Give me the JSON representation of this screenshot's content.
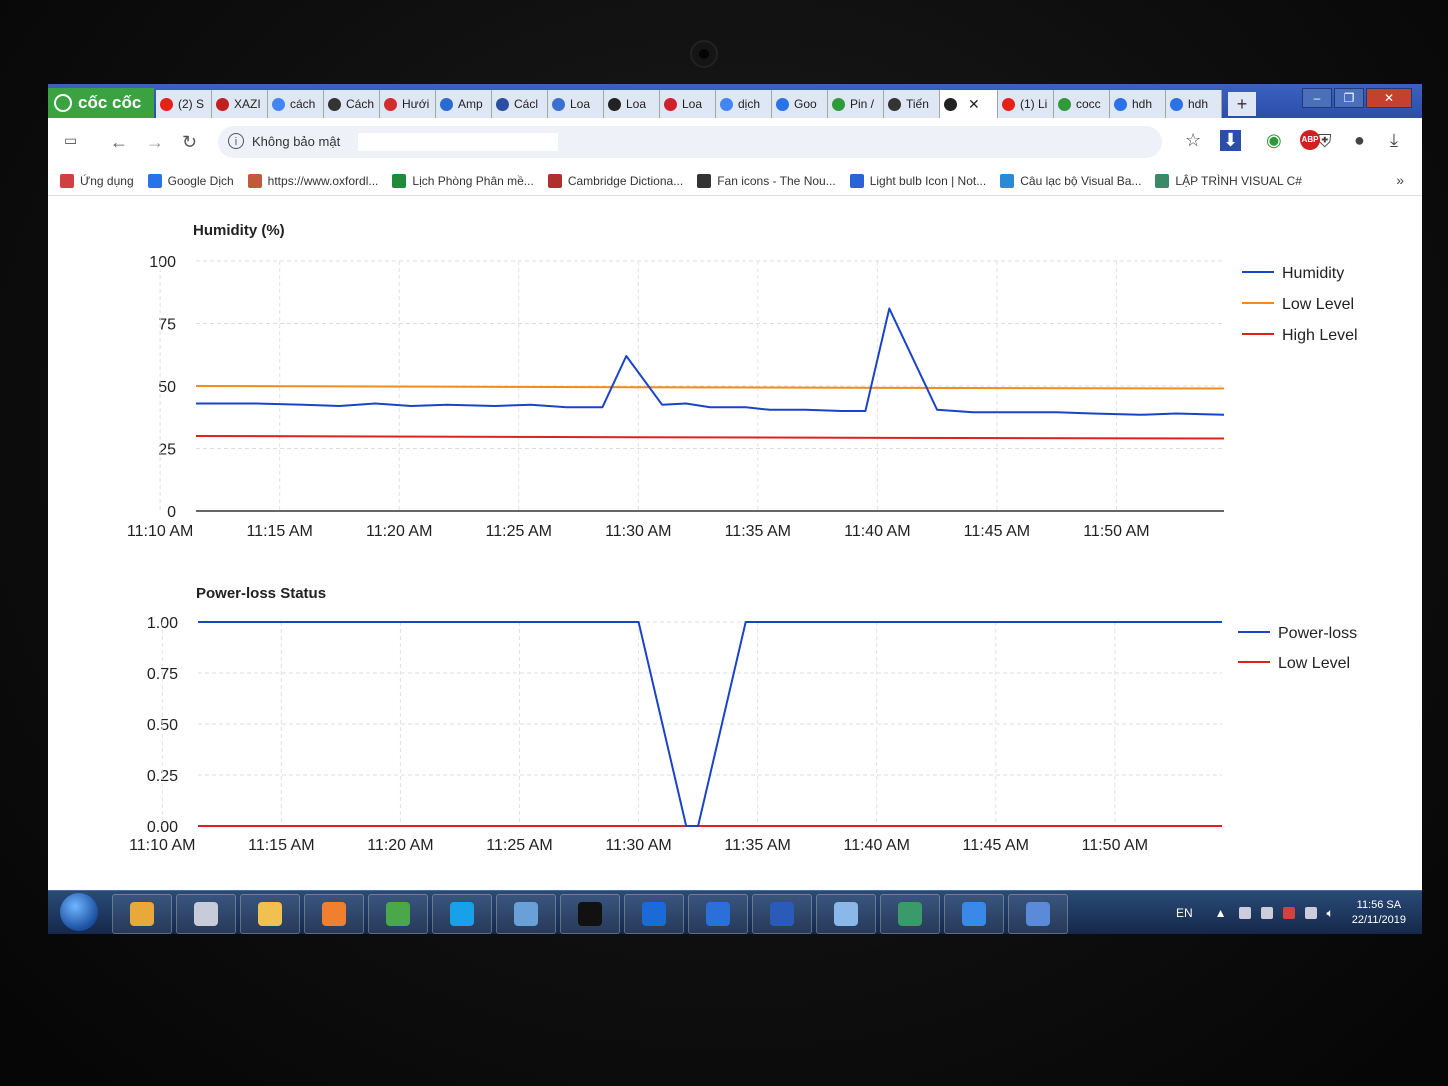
{
  "browser": {
    "brand": "cốc cốc",
    "tabs": [
      {
        "label": "(2) S",
        "icon": "youtube-icon",
        "color": "#e62117"
      },
      {
        "label": "XAZI",
        "icon": "block-icon",
        "color": "#c02020"
      },
      {
        "label": "cách",
        "icon": "google-icon",
        "color": "#4285f4"
      },
      {
        "label": "Cách",
        "icon": "globe-icon",
        "color": "#333333"
      },
      {
        "label": "Hưới",
        "icon": "app-icon",
        "color": "#d22d2d"
      },
      {
        "label": "Amp",
        "icon": "edge-icon",
        "color": "#2a6bd1"
      },
      {
        "label": "Cácl",
        "icon": "arrow-icon",
        "color": "#2a4fa0"
      },
      {
        "label": "Loa",
        "icon": "pen-icon",
        "color": "#3a6fd1"
      },
      {
        "label": "Loa",
        "icon": "play-icon",
        "color": "#222222"
      },
      {
        "label": "Loa",
        "icon": "kc-icon",
        "color": "#d0202a"
      },
      {
        "label": "dịch",
        "icon": "google-icon",
        "color": "#4285f4"
      },
      {
        "label": "Goo",
        "icon": "translate-icon",
        "color": "#2a72e8"
      },
      {
        "label": "Pin /",
        "icon": "pen-icon",
        "color": "#2f9a3a"
      },
      {
        "label": "Tiến",
        "icon": "globe-icon",
        "color": "#333333"
      },
      {
        "label": "",
        "icon": "close-circle-icon",
        "color": "#222222",
        "active": true
      },
      {
        "label": "(1) Li",
        "icon": "youtube-icon",
        "color": "#e62117"
      },
      {
        "label": "cocc",
        "icon": "download-icon",
        "color": "#2f9a3a"
      },
      {
        "label": "hdh",
        "icon": "web-icon",
        "color": "#2a72e8"
      },
      {
        "label": "hdh",
        "icon": "web-icon",
        "color": "#2a72e8"
      }
    ],
    "new_tab": "+",
    "security_label": "Không bảo mật",
    "bookmarks": [
      {
        "label": "Ứng dụng",
        "color": "#d04040"
      },
      {
        "label": "Google Dịch",
        "color": "#2a72e8"
      },
      {
        "label": "https://www.oxfordl...",
        "color": "#c05a3a"
      },
      {
        "label": "Lịch Phòng Phân mề...",
        "color": "#1f8a3a"
      },
      {
        "label": "Cambridge Dictiona...",
        "color": "#b03030"
      },
      {
        "label": "Fan icons - The Nou...",
        "color": "#333333"
      },
      {
        "label": "Light bulb Icon | Not...",
        "color": "#2a62d8"
      },
      {
        "label": "Câu lạc bộ Visual Ba...",
        "color": "#2a8ad8"
      },
      {
        "label": "LẬP TRÌNH VISUAL C#",
        "color": "#3a8a6a"
      }
    ],
    "bookmarks_more": "»"
  },
  "chart_data": [
    {
      "type": "line",
      "title": "Humidity (%)",
      "ylim": [
        0,
        100
      ],
      "yticks": [
        "100",
        "75",
        "50",
        "25",
        "0"
      ],
      "x_tick_labels": [
        "11:10 AM",
        "11:15 AM",
        "11:20 AM",
        "11:25 AM",
        "11:30 AM",
        "11:35 AM",
        "11:40 AM",
        "11:45 AM",
        "11:50 AM"
      ],
      "x_range_minutes": [
        11.5,
        54.5
      ],
      "series": [
        {
          "name": "Humidity",
          "color": "#1a44c8",
          "points": [
            [
              11.5,
              43
            ],
            [
              14,
              43
            ],
            [
              16,
              42.5
            ],
            [
              17.5,
              42
            ],
            [
              19,
              43
            ],
            [
              20.5,
              42
            ],
            [
              22,
              42.5
            ],
            [
              24,
              42
            ],
            [
              25.5,
              42.5
            ],
            [
              27,
              41.5
            ],
            [
              28.5,
              41.5
            ],
            [
              29.5,
              62
            ],
            [
              31,
              42.5
            ],
            [
              32,
              43
            ],
            [
              33,
              41.5
            ],
            [
              34.5,
              41.5
            ],
            [
              35.5,
              40.5
            ],
            [
              37,
              40.5
            ],
            [
              38.5,
              40
            ],
            [
              39.5,
              40
            ],
            [
              40.5,
              81
            ],
            [
              42.5,
              40.5
            ],
            [
              44,
              39.5
            ],
            [
              45.5,
              39.5
            ],
            [
              47.5,
              39.5
            ],
            [
              49,
              39
            ],
            [
              51,
              38.5
            ],
            [
              52.5,
              39
            ],
            [
              54.5,
              38.5
            ]
          ]
        },
        {
          "name": "Low Level",
          "color": "#f08c1e",
          "points": [
            [
              11.5,
              50
            ],
            [
              30,
              49.5
            ],
            [
              54.5,
              49
            ]
          ]
        },
        {
          "name": "High Level",
          "color": "#e02020",
          "points": [
            [
              11.5,
              30
            ],
            [
              30,
              29.5
            ],
            [
              54.5,
              29
            ]
          ]
        }
      ]
    },
    {
      "type": "line",
      "title": "Power-loss Status",
      "ylim": [
        0,
        1
      ],
      "yticks": [
        "1.00",
        "0.75",
        "0.50",
        "0.25",
        "0.00"
      ],
      "x_tick_labels": [
        "11:10 AM",
        "11:15 AM",
        "11:20 AM",
        "11:25 AM",
        "11:30 AM",
        "11:35 AM",
        "11:40 AM",
        "11:45 AM",
        "11:50 AM"
      ],
      "x_range_minutes": [
        11.5,
        54.5
      ],
      "series": [
        {
          "name": "Power-loss",
          "color": "#1a44c8",
          "points": [
            [
              11.5,
              1
            ],
            [
              30,
              1
            ],
            [
              31,
              0.5
            ],
            [
              32,
              0
            ],
            [
              32.5,
              0
            ],
            [
              33.5,
              0.5
            ],
            [
              34.5,
              1
            ],
            [
              54.5,
              1
            ]
          ]
        },
        {
          "name": "Low Level",
          "color": "#e02020",
          "points": [
            [
              11.5,
              0
            ],
            [
              54.5,
              0
            ]
          ]
        }
      ]
    }
  ],
  "taskbar": {
    "apps": [
      {
        "icon": "paint-icon",
        "color": "#e8a83a"
      },
      {
        "icon": "usb-icon",
        "color": "#c8ccd8"
      },
      {
        "icon": "explorer-icon",
        "color": "#f0c050"
      },
      {
        "icon": "media-player-icon",
        "color": "#f08030"
      },
      {
        "icon": "coccoc-icon",
        "color": "#4aa84a"
      },
      {
        "icon": "skype-icon",
        "color": "#18a0e8"
      },
      {
        "icon": "paint-brush-icon",
        "color": "#6aa0d8"
      },
      {
        "icon": "cmd-icon",
        "color": "#111111"
      },
      {
        "icon": "teamviewer-icon",
        "color": "#1a6ad8"
      },
      {
        "icon": "network-icon",
        "color": "#2a70d8"
      },
      {
        "icon": "word-icon",
        "color": "#2a5bb8"
      },
      {
        "icon": "notes-icon",
        "color": "#8ab8e8"
      },
      {
        "icon": "window-switch-icon",
        "color": "#3a9a6a"
      },
      {
        "icon": "ie-icon",
        "color": "#3a88e8"
      },
      {
        "icon": "remote-desktop-icon",
        "color": "#5a8ad8"
      }
    ],
    "language": "EN",
    "time": "11:56 SA",
    "date": "22/11/2019"
  }
}
